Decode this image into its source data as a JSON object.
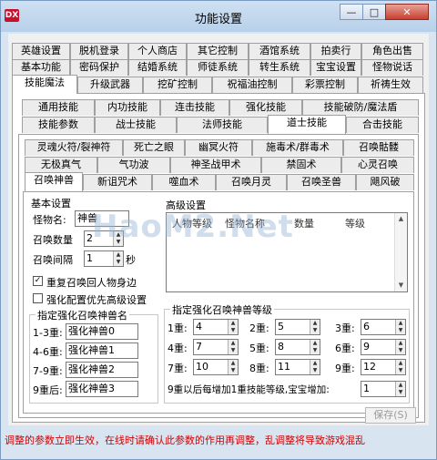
{
  "window": {
    "title": "功能设置",
    "app_icon_text": "DX",
    "min_icon": "minimize-icon",
    "max_icon": "maximize-icon",
    "close_icon": "close-icon",
    "min_label": "—",
    "max_label": "□",
    "close_label": "✕"
  },
  "tabs_row1": [
    "英雄设置",
    "脱机登录",
    "个人商店",
    "其它控制",
    "酒馆系统",
    "拍卖行",
    "角色出售"
  ],
  "tabs_row2": [
    "基本功能",
    "密码保护",
    "结婚系统",
    "师徒系统",
    "转生系统",
    "宝宝设置",
    "怪物说话"
  ],
  "tabs_row3": [
    "技能魔法",
    "升级武器",
    "挖矿控制",
    "祝福油控制",
    "彩票控制",
    "祈祷生效"
  ],
  "tabs_row4": [
    "通用技能",
    "内功技能",
    "连击技能",
    "强化技能",
    "技能破防/魔法盾"
  ],
  "tabs_row5": [
    "技能参数",
    "战士技能",
    "法师技能",
    "道士技能",
    "合击技能"
  ],
  "tabs_row6": [
    "灵魂火符/裂神符",
    "死亡之眼",
    "幽冥火符",
    "施毒术/群毒术",
    "召唤骷髅"
  ],
  "tabs_row7": [
    "无极真气",
    "气功波",
    "神圣战甲术",
    "禁固术",
    "心灵召唤"
  ],
  "tabs_row8": [
    "召唤神兽",
    "新诅咒术",
    "噬血术",
    "召唤月灵",
    "召唤圣兽",
    "飓风破"
  ],
  "basic": {
    "title": "基本设置",
    "monster_name_label": "怪物名:",
    "monster_name_value": "神兽",
    "summon_count_label": "召唤数量",
    "summon_count_value": "2",
    "summon_interval_label": "召唤间隔",
    "summon_interval_value": "1",
    "seconds_unit": "秒"
  },
  "advanced": {
    "title": "高级设置",
    "columns": [
      "人物等级",
      "怪物名称",
      "数量",
      "等级"
    ]
  },
  "checkbox1": {
    "label": "重复召唤回人物身边",
    "checked": true,
    "mark": "✓"
  },
  "checkbox2": {
    "label": "强化配置优先高级设置",
    "checked": false,
    "mark": ""
  },
  "names": {
    "title": "指定强化召唤神兽名",
    "rows": [
      {
        "label": "1-3重:",
        "value": "强化神兽0"
      },
      {
        "label": "4-6重:",
        "value": "强化神兽1"
      },
      {
        "label": "7-9重:",
        "value": "强化神兽2"
      },
      {
        "label": "9重后:",
        "value": "强化神兽3"
      }
    ]
  },
  "levels": {
    "title": "指定强化召唤神兽等级",
    "items": [
      {
        "label": "1重:",
        "value": "4"
      },
      {
        "label": "2重:",
        "value": "5"
      },
      {
        "label": "3重:",
        "value": "6"
      },
      {
        "label": "4重:",
        "value": "7"
      },
      {
        "label": "5重:",
        "value": "8"
      },
      {
        "label": "6重:",
        "value": "9"
      },
      {
        "label": "7重:",
        "value": "10"
      },
      {
        "label": "8重:",
        "value": "11"
      },
      {
        "label": "9重:",
        "value": "12"
      }
    ],
    "extra_label": "9重以后每增加1重技能等级,宝宝增加:",
    "extra_value": "1"
  },
  "save_button": "保存(S)",
  "watermark": "HaoM2.Net",
  "footer": "调整的参数立即生效，在线时请确认此参数的作用再调整，乱调整将导致游戏混乱"
}
